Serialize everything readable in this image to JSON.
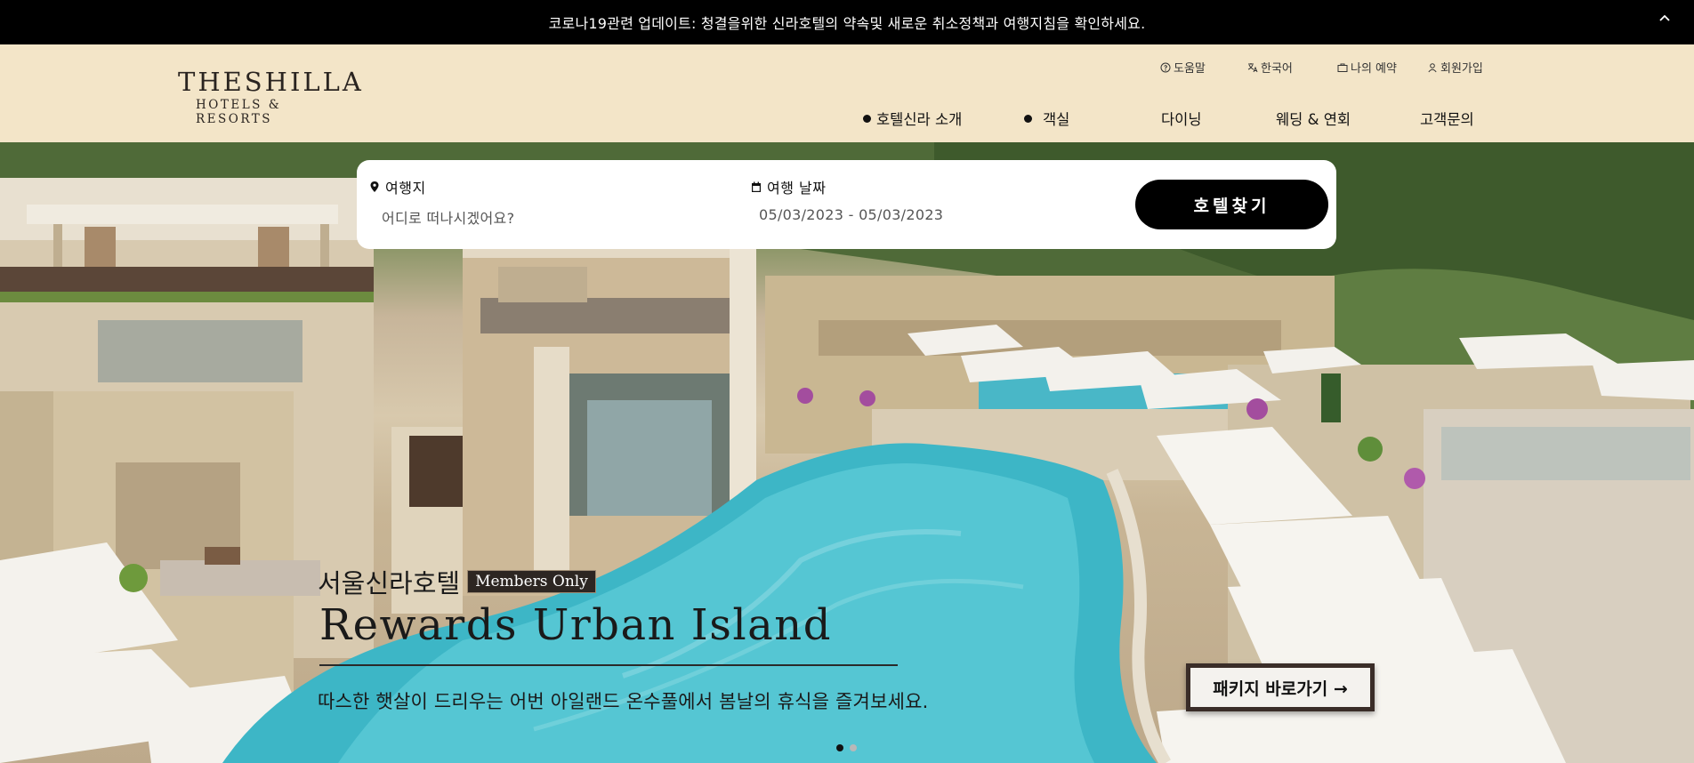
{
  "notice": {
    "text": "코로나19관련 업데이트: 청결을위한 신라호텔의 약속및 새로운 취소정책과 여행지침을 확인하세요."
  },
  "header": {
    "logo_line1": "THESHILLA",
    "logo_line2": "HOTELS & RESORTS",
    "utility": {
      "help": "도움말",
      "language": "한국어",
      "reservation": "나의 예약",
      "signup": "회원가입"
    },
    "nav": {
      "about": "호텔신라 소개",
      "rooms": "객실",
      "dining": "다이닝",
      "wedding": "웨딩 & 연회",
      "support": "고객문의"
    }
  },
  "search": {
    "destination_label": "여행지",
    "destination_placeholder": "어디로 떠나시겠어요?",
    "date_label": "여행 날짜",
    "date_value": "05/03/2023 - 05/03/2023",
    "button_label": "호텔찾기"
  },
  "promo": {
    "subtitle": "서울신라호텔",
    "badge": "Members Only",
    "title": "Rewards Urban Island",
    "description": "따스한 햇살이 드리우는 어번 아일랜드 온수풀에서 봄날의 휴식을 즐겨보세요.",
    "cta": "패키지 바로가기 →"
  },
  "carousel": {
    "count": 2,
    "active_index": 0
  },
  "colors": {
    "header_bg": "#f3e5c8",
    "notice_bg": "#000000",
    "pool": "#3fb8c8",
    "button_bg": "#000000"
  },
  "icons": {
    "notice_toggle": "chevron-up-icon",
    "help": "question-circle-icon",
    "language": "translate-icon",
    "reservation": "briefcase-icon",
    "signup": "person-icon",
    "destination": "map-pin-icon",
    "date": "calendar-icon"
  }
}
